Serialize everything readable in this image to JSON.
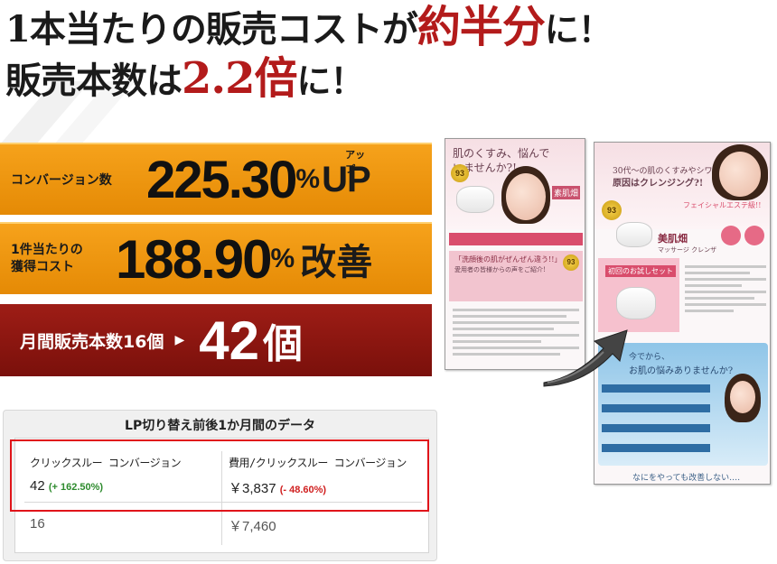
{
  "headline": {
    "line1_a": "1本当たりの販売コストが",
    "line1_b": "約半分",
    "line1_c": "に！",
    "line2_a": "販売本数は",
    "line2_b": "2.2倍",
    "line2_c": "に！"
  },
  "banner1": {
    "label": "コンバージョン数",
    "value": "225.30",
    "pct": "%",
    "up": "UP",
    "up_kana": "アップ"
  },
  "banner2": {
    "label_line1": "1件当たりの",
    "label_line2": "獲得コスト",
    "value": "188.90",
    "pct": "%",
    "suffix": "改善"
  },
  "banner3": {
    "label": "月間販売本数16個",
    "arrow": "▶",
    "value": "42",
    "unit": "個"
  },
  "table": {
    "title": "LP切り替え前後1か月間のデータ",
    "col1_header": "クリックスルー コンバージョン",
    "col2_header": "費用/クリックスルー コンバージョン",
    "after": {
      "col1": "42",
      "col1_change": "(+ 162.50%)",
      "col2": "￥3,837",
      "col2_change": "(- 48.60%)"
    },
    "before": {
      "col1": "16",
      "col2": "￥7,460"
    }
  },
  "lp_old": {
    "hero_line1": "肌のくすみ、悩んで",
    "hero_line2": "いませんか?!",
    "product": "素肌畑",
    "badge": "93",
    "section_title": "「洗顔後の肌がぜんぜん違う!!」",
    "section_sub": "愛用者の皆様からの声をご紹介!"
  },
  "lp_new": {
    "hero_line1": "30代〜の肌のくすみやシワ‥",
    "hero_line2": "原因はクレンジング?!",
    "product": "美肌畑",
    "product_sub": "マッサージ クレンザ",
    "offer": "フェイシャルエステ級!!",
    "badge": "93",
    "box_title": "初回のお試しセット",
    "question_line1": "今でから、",
    "question_line2": "お肌の悩みありませんか?",
    "bottom": "なにをやっても改善しない‥‥"
  },
  "colors": {
    "orange": "#f29a12",
    "dark_red": "#8e1711",
    "accent_red": "#b31b1b",
    "highlight": "#e0141a"
  }
}
